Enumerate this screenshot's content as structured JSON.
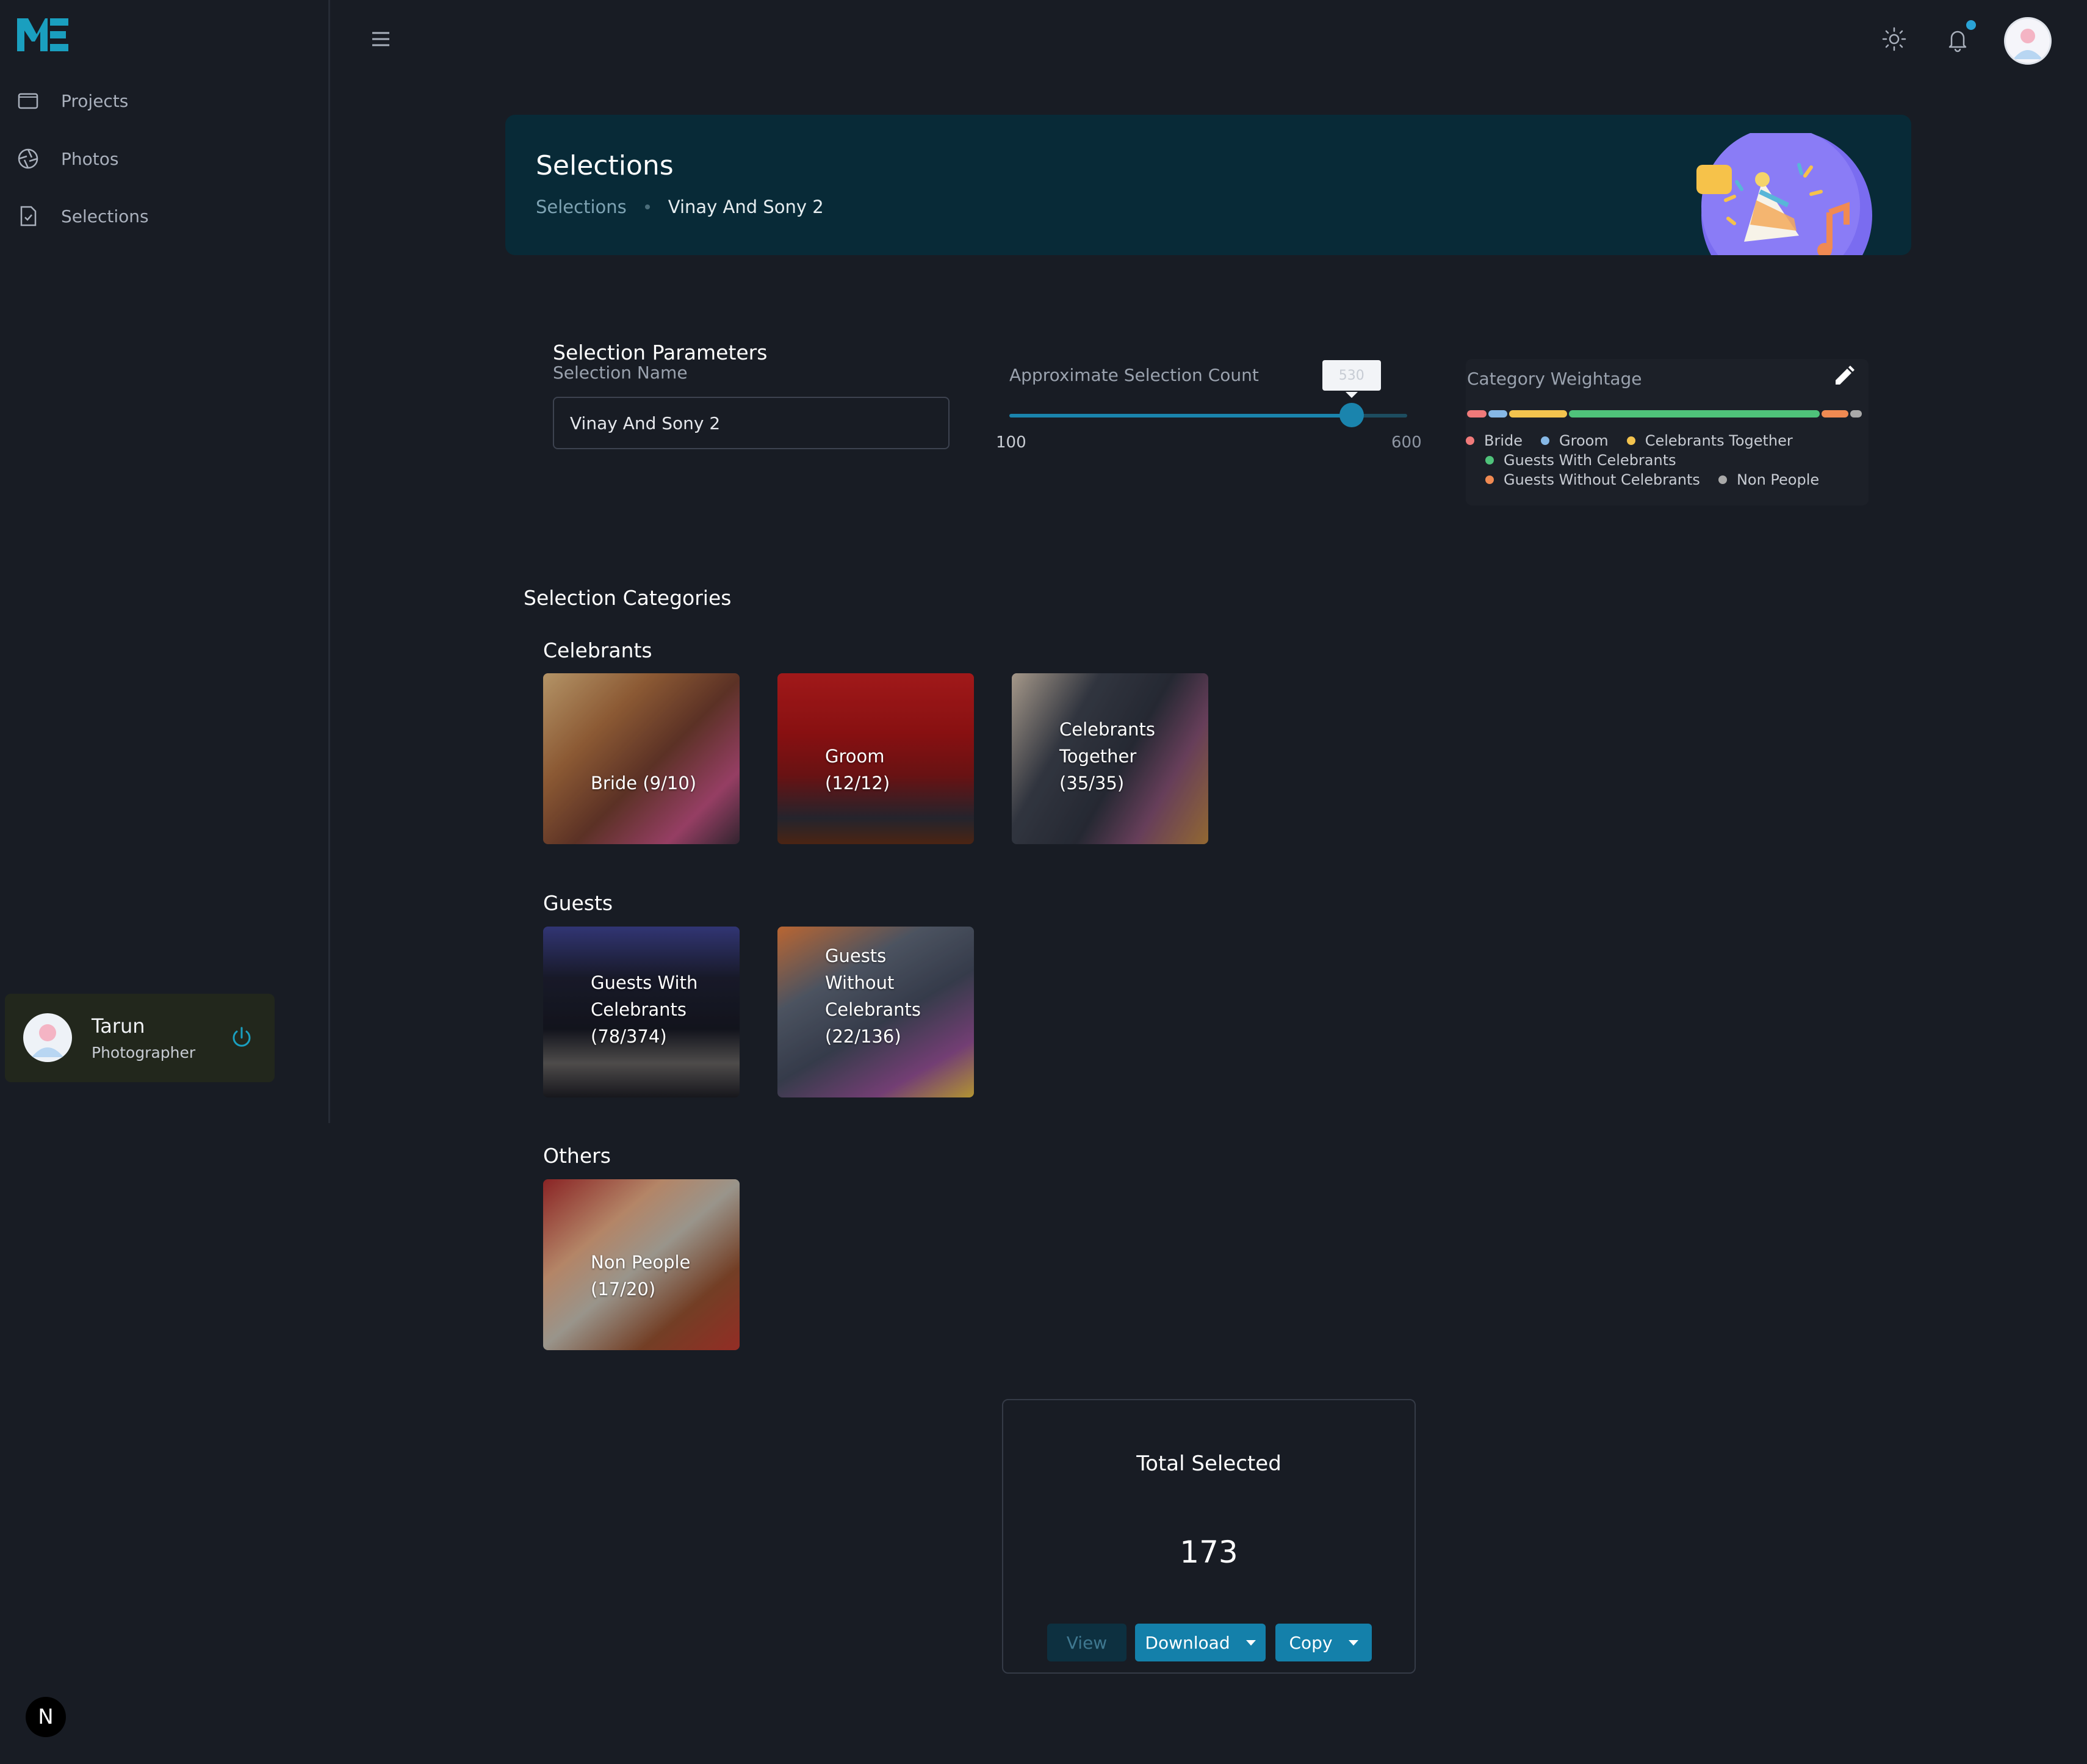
{
  "brand": {
    "logo_text": "ME",
    "accent": "#1a84ad"
  },
  "sidebar": {
    "items": [
      {
        "label": "Projects",
        "icon": "folder-icon"
      },
      {
        "label": "Photos",
        "icon": "aperture-icon"
      },
      {
        "label": "Selections",
        "icon": "document-icon"
      }
    ],
    "user": {
      "name": "Tarun",
      "role": "Photographer"
    }
  },
  "banner": {
    "title": "Selections",
    "breadcrumb": [
      "Selections",
      "Vinay And Sony 2"
    ]
  },
  "parameters": {
    "title": "Selection Parameters",
    "name_label": "Selection Name",
    "name_value": "Vinay And Sony 2",
    "slider": {
      "label": "Approximate Selection Count",
      "min": 100,
      "max": 600,
      "value": 530,
      "min_label": "100",
      "max_label": "600",
      "tooltip": "530"
    },
    "weightage": {
      "label": "Category Weightage",
      "segments": [
        {
          "name": "Bride",
          "color": "#f07a7a",
          "share": 0.05
        },
        {
          "name": "Groom",
          "color": "#86b8e6",
          "share": 0.05
        },
        {
          "name": "Celebrants Together",
          "color": "#f3c34e",
          "share": 0.15
        },
        {
          "name": "Guests With Celebrants",
          "color": "#4fc27a",
          "share": 0.65
        },
        {
          "name": "Guests Without Celebrants",
          "color": "#f08a52",
          "share": 0.07
        },
        {
          "name": "Non People",
          "color": "#a9a9a9",
          "share": 0.03
        }
      ]
    }
  },
  "categories": {
    "heading": "Selection Categories",
    "groups": [
      {
        "label": "Celebrants",
        "items": [
          {
            "label": "Bride (9/10)"
          },
          {
            "label": "Groom (12/12)"
          },
          {
            "label": "Celebrants Together (35/35)"
          }
        ]
      },
      {
        "label": "Guests",
        "items": [
          {
            "label": "Guests With Celebrants (78/374)"
          },
          {
            "label": "Guests Without Celebrants (22/136)"
          }
        ]
      },
      {
        "label": "Others",
        "items": [
          {
            "label": "Non People (17/20)"
          }
        ]
      }
    ]
  },
  "total": {
    "title": "Total Selected",
    "count": "173",
    "view_label": "View",
    "download_label": "Download",
    "copy_label": "Copy"
  },
  "badge": "N"
}
